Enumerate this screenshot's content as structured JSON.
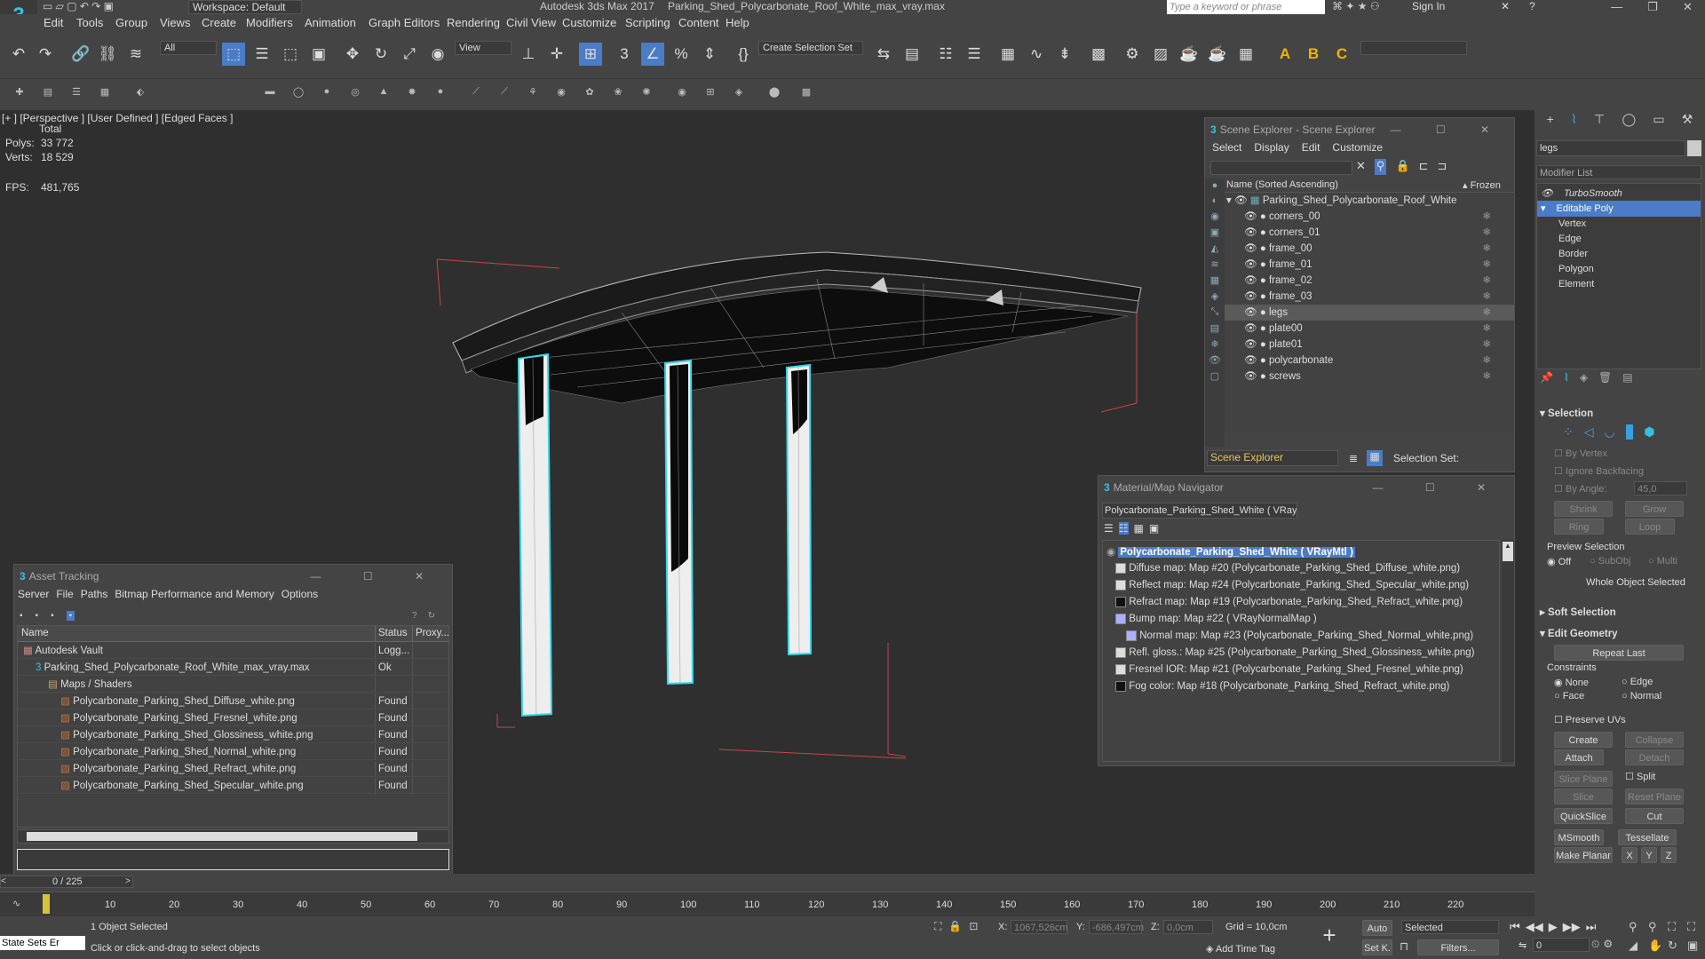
{
  "window": {
    "app_title": "Autodesk 3ds Max 2017",
    "file_title": "Parking_Shed_Polycarbonate_Roof_White_max_vray.max",
    "workspace": "Workspace: Default",
    "search_placeholder": "Type a keyword or phrase",
    "sign_in": "Sign In"
  },
  "menu": [
    "Edit",
    "Tools",
    "Group",
    "Views",
    "Create",
    "Modifiers",
    "Animation",
    "Graph Editors",
    "Rendering",
    "Civil View",
    "Customize",
    "Scripting",
    "Content",
    "Help"
  ],
  "toolbar": {
    "filter": "All",
    "view": "View",
    "selection_set": "Create Selection Set"
  },
  "viewport": {
    "label": "[+ ] [Perspective ]  [User Defined ] [Edged Faces ]",
    "stats_total": "Total",
    "polys_label": "Polys:",
    "polys_value": "33 772",
    "verts_label": "Verts:",
    "verts_value": "18 529",
    "fps_label": "FPS:",
    "fps_value": "481,765"
  },
  "scene_explorer": {
    "title": "Scene Explorer - Scene Explorer",
    "menu": [
      "Select",
      "Display",
      "Edit",
      "Customize"
    ],
    "col_name": "Name (Sorted Ascending)",
    "col_frozen": "▴ Frozen",
    "root": "Parking_Shed_Polycarbonate_Roof_White",
    "items": [
      "corners_00",
      "corners_01",
      "frame_00",
      "frame_01",
      "frame_02",
      "frame_03",
      "legs",
      "plate00",
      "plate01",
      "polycarbonate",
      "screws"
    ],
    "selected_index": 6,
    "footer_label": "Scene Explorer",
    "selection_set": "Selection Set:"
  },
  "material_nav": {
    "title": "Material/Map Navigator",
    "field": "Polycarbonate_Parking_Shed_White  ( VRayM",
    "root": "Polycarbonate_Parking_Shed_White  ( VRayMtl )",
    "items": [
      "Diffuse map: Map #20 (Polycarbonate_Parking_Shed_Diffuse_white.png)",
      "Reflect map: Map #24 (Polycarbonate_Parking_Shed_Specular_white.png)",
      "Refract map: Map #19 (Polycarbonate_Parking_Shed_Refract_white.png)",
      "Bump map: Map #22  ( VRayNormalMap )",
      "Normal map: Map #23 (Polycarbonate_Parking_Shed_Normal_white.png)",
      "Refl. gloss.: Map #25 (Polycarbonate_Parking_Shed_Glossiness_white.png)",
      "Fresnel IOR: Map #21 (Polycarbonate_Parking_Shed_Fresnel_white.png)",
      "Fog color: Map #18 (Polycarbonate_Parking_Shed_Refract_white.png)"
    ]
  },
  "asset_tracking": {
    "title": "Asset Tracking",
    "menu": [
      "Server",
      "File",
      "Paths",
      "Bitmap Performance and Memory",
      "Options"
    ],
    "col_name": "Name",
    "col_status": "Status",
    "col_proxy": "Proxy...",
    "rows": [
      {
        "name": "Autodesk Vault",
        "status": "Logg...",
        "indent": 0
      },
      {
        "name": "Parking_Shed_Polycarbonate_Roof_White_max_vray.max",
        "status": "Ok",
        "indent": 1
      },
      {
        "name": "Maps / Shaders",
        "status": "",
        "indent": 2
      },
      {
        "name": "Polycarbonate_Parking_Shed_Diffuse_white.png",
        "status": "Found",
        "indent": 3
      },
      {
        "name": "Polycarbonate_Parking_Shed_Fresnel_white.png",
        "status": "Found",
        "indent": 3
      },
      {
        "name": "Polycarbonate_Parking_Shed_Glossiness_white.png",
        "status": "Found",
        "indent": 3
      },
      {
        "name": "Polycarbonate_Parking_Shed_Normal_white.png",
        "status": "Found",
        "indent": 3
      },
      {
        "name": "Polycarbonate_Parking_Shed_Refract_white.png",
        "status": "Found",
        "indent": 3
      },
      {
        "name": "Polycarbonate_Parking_Shed_Specular_white.png",
        "status": "Found",
        "indent": 3
      }
    ]
  },
  "command_panel": {
    "object_name": "legs",
    "modifier_list": "Modifier List",
    "stack": [
      "TurboSmooth",
      "Editable Poly",
      "Vertex",
      "Edge",
      "Border",
      "Polygon",
      "Element"
    ],
    "selection_title": "Selection",
    "by_vertex": "By Vertex",
    "ignore_backfacing": "Ignore Backfacing",
    "by_angle": "By Angle:",
    "by_angle_value": "45,0",
    "shrink": "Shrink",
    "grow": "Grow",
    "ring": "Ring",
    "loop": "Loop",
    "preview_selection": "Preview Selection",
    "off": "Off",
    "subobj": "SubObj",
    "multi": "Multi",
    "whole_object": "Whole Object Selected",
    "soft_selection": "Soft Selection",
    "edit_geometry": "Edit Geometry",
    "repeat_last": "Repeat Last",
    "constraints": "Constraints",
    "none": "None",
    "edge": "Edge",
    "face": "Face",
    "normal": "Normal",
    "preserve_uvs": "Preserve UVs",
    "create": "Create",
    "collapse": "Collapse",
    "attach": "Attach",
    "detach": "Detach",
    "slice_plane": "Slice Plane",
    "split": "Split",
    "slice": "Slice",
    "reset_plane": "Reset Plane",
    "quickslice": "QuickSlice",
    "cut": "Cut",
    "msmooth": "MSmooth",
    "tessellate": "Tessellate",
    "make_planar": "Make Planar",
    "x": "X",
    "y": "Y",
    "z": "Z"
  },
  "timeline": {
    "frame": "0 / 225",
    "ticks": [
      "10",
      "20",
      "30",
      "40",
      "50",
      "60",
      "70",
      "80",
      "90",
      "100",
      "110",
      "120",
      "130",
      "140",
      "150",
      "160",
      "170",
      "180",
      "190",
      "200",
      "210",
      "220"
    ]
  },
  "status": {
    "maxscript": "State Sets Er",
    "selected": "1 Object Selected",
    "prompt": "Click or click-and-drag to select objects",
    "x_label": "X:",
    "x_value": "1067,526cm",
    "y_label": "Y:",
    "y_value": "-686,497cm",
    "z_label": "Z:",
    "z_value": "0,0cm",
    "grid": "Grid = 10,0cm",
    "add_time_tag": "Add Time Tag",
    "auto": "Auto",
    "selected_dd": "Selected",
    "setk": "Set K.",
    "filters": "Filters...",
    "frame_value": "0"
  },
  "colors": {
    "accent": "#5a9bd5",
    "cyan": "#36d6e7",
    "selection": "#4a7cc7"
  }
}
